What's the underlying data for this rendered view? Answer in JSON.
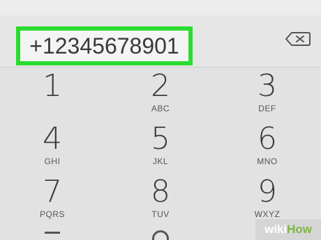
{
  "dialer": {
    "number": "+12345678901",
    "backspace_icon": "backspace-icon",
    "accent_color": "#2bdc30"
  },
  "keypad": {
    "keys": [
      {
        "digit": "1",
        "letters": ""
      },
      {
        "digit": "2",
        "letters": "ABC"
      },
      {
        "digit": "3",
        "letters": "DEF"
      },
      {
        "digit": "4",
        "letters": "GHI"
      },
      {
        "digit": "5",
        "letters": "JKL"
      },
      {
        "digit": "6",
        "letters": "MNO"
      },
      {
        "digit": "7",
        "letters": "PQRS"
      },
      {
        "digit": "8",
        "letters": "TUV"
      },
      {
        "digit": "9",
        "letters": "WXYZ"
      }
    ]
  },
  "watermark": {
    "part1": "wiki",
    "part2": "How"
  }
}
